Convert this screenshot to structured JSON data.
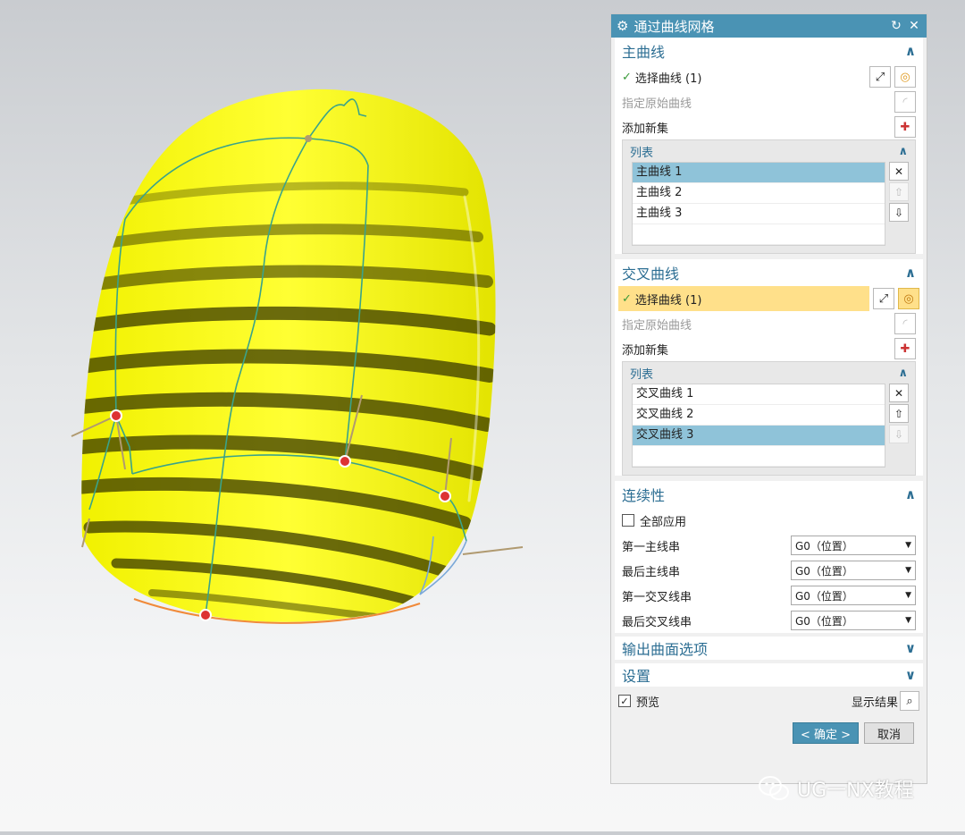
{
  "dialog": {
    "title": "通过曲线网格",
    "primary": {
      "heading": "主曲线",
      "select_label": "选择曲线 (1)",
      "specify_label": "指定原始曲线",
      "add_set_label": "添加新集",
      "list_heading": "列表",
      "items": [
        "主曲线 1",
        "主曲线 2",
        "主曲线 3"
      ]
    },
    "cross": {
      "heading": "交叉曲线",
      "select_label": "选择曲线 (1)",
      "specify_label": "指定原始曲线",
      "add_set_label": "添加新集",
      "list_heading": "列表",
      "items": [
        "交叉曲线 1",
        "交叉曲线 2",
        "交叉曲线 3"
      ]
    },
    "continuity": {
      "heading": "连续性",
      "apply_all_label": "全部应用",
      "rows": [
        {
          "label": "第一主线串",
          "value": "G0（位置）"
        },
        {
          "label": "最后主线串",
          "value": "G0（位置）"
        },
        {
          "label": "第一交叉线串",
          "value": "G0（位置）"
        },
        {
          "label": "最后交叉线串",
          "value": "G0（位置）"
        }
      ]
    },
    "output_heading": "输出曲面选项",
    "settings_heading": "设置",
    "preview_label": "预览",
    "show_result_label": "显示结果",
    "ok_label": "< 确定 >",
    "cancel_label": "取消"
  },
  "watermark": "UG一NX教程",
  "colors": {
    "accent": "#4a93b4",
    "surface": "#ffff1a",
    "curve": "#3aa38a",
    "selection": "#ffe08a"
  }
}
